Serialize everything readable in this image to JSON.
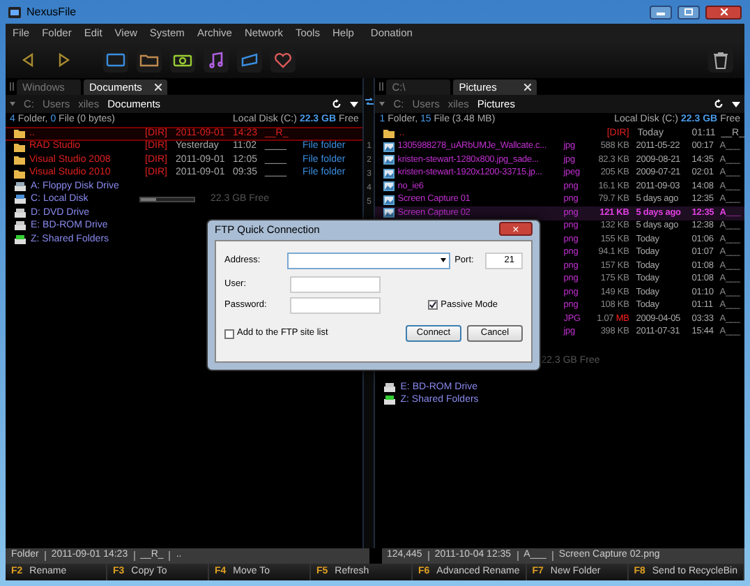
{
  "window": {
    "title": "NexusFile"
  },
  "menu": [
    "File",
    "Folder",
    "Edit",
    "View",
    "System",
    "Archive",
    "Network",
    "Tools",
    "Help",
    "Donation"
  ],
  "splitter_marks": [
    "1",
    "2",
    "3",
    "4",
    "5"
  ],
  "left": {
    "tabs": [
      {
        "label": "Windows",
        "selected": false
      },
      {
        "label": "Documents",
        "selected": true
      }
    ],
    "breadcrumb": [
      "C:",
      "Users",
      "xiles",
      "Documents"
    ],
    "summary": "**4** Folder, **0** File (0 bytes)",
    "disk": "Local Disk (C:)",
    "disk_size": "22.3 GB",
    "disk_free": "Free",
    "folders": [
      {
        "name": "..",
        "tag": "[DIR]",
        "date": "2011-09-01",
        "time": "14:23",
        "attr": "__R_",
        "selected": true
      },
      {
        "name": "RAD Studio",
        "tag": "[DIR]",
        "date": "Yesterday",
        "time": "11:02",
        "attr": "____",
        "type": "File folder",
        "selected": false
      },
      {
        "name": "Visual Studio 2008",
        "tag": "[DIR]",
        "date": "2011-09-01",
        "time": "12:05",
        "attr": "____",
        "type": "File folder",
        "selected": false
      },
      {
        "name": "Visual Studio 2010",
        "tag": "[DIR]",
        "date": "2011-09-01",
        "time": "09:35",
        "attr": "____",
        "type": "File folder",
        "selected": false
      }
    ],
    "drives": [
      {
        "kind": "floppy",
        "name": "A: Floppy Disk Drive"
      },
      {
        "kind": "disk",
        "name": "C: Local Disk",
        "level": 0.3,
        "free": "22.3 GB Free"
      },
      {
        "kind": "optical",
        "name": "D: DVD Drive"
      },
      {
        "kind": "optical",
        "name": "E: BD-ROM Drive"
      },
      {
        "kind": "network",
        "name": "Z: Shared Folders"
      }
    ],
    "status": [
      "Folder",
      "2011-09-01 14:23",
      "__R_",
      ".."
    ]
  },
  "right": {
    "tabs": [
      {
        "label": "C:\\",
        "selected": false
      },
      {
        "label": "Pictures",
        "selected": true
      }
    ],
    "breadcrumb": [
      "C:",
      "Users",
      "xiles",
      "Pictures"
    ],
    "summary": "**1** Folder, **15** File (3.48 MB)",
    "disk": "Local Disk (C:)",
    "disk_size": "22.3 GB",
    "disk_free": "Free",
    "folders": [
      {
        "name": "..",
        "tag": "[DIR]",
        "date": "Today",
        "time": "01:11",
        "attr": "__R_"
      }
    ],
    "files": [
      {
        "name": "1305988278_uARbUMJe_Wallcate.c...",
        "ext": "jpg",
        "size": "588 KB",
        "date": "2011-05-22",
        "time": "00:17",
        "attr": "A___",
        "selected": false,
        "large": false
      },
      {
        "name": "kristen-stewart-1280x800.jpg_sade...",
        "ext": "jpg",
        "size": "82.3 KB",
        "date": "2009-08-21",
        "time": "14:35",
        "attr": "A___",
        "selected": false,
        "large": false
      },
      {
        "name": "kristen-stewart-1920x1200-33715.jp...",
        "ext": "jpeg",
        "size": "205 KB",
        "date": "2009-07-21",
        "time": "02:01",
        "attr": "A___",
        "selected": false,
        "large": false
      },
      {
        "name": "no_ie6",
        "ext": "png",
        "size": "16.1 KB",
        "date": "2011-09-03",
        "time": "14:08",
        "attr": "A___",
        "selected": false,
        "large": false
      },
      {
        "name": "Screen Capture 01",
        "ext": "png",
        "size": "79.7 KB",
        "date": "5 days ago",
        "time": "12:35",
        "attr": "A___",
        "selected": false,
        "large": false
      },
      {
        "name": "Screen Capture 02",
        "ext": "png",
        "size": "121 KB",
        "date": "5 days ago",
        "time": "12:35",
        "attr": "A___",
        "selected": true,
        "large": false
      },
      {
        "ext": "png",
        "size": "132 KB",
        "date": "5 days ago",
        "time": "12:38",
        "attr": "A___",
        "selected": false,
        "large": false
      },
      {
        "ext": "png",
        "size": "155 KB",
        "date": "Today",
        "time": "01:06",
        "attr": "A___",
        "selected": false,
        "large": false
      },
      {
        "ext": "png",
        "size": "94.1 KB",
        "date": "Today",
        "time": "01:07",
        "attr": "A___",
        "selected": false,
        "large": false
      },
      {
        "ext": "png",
        "size": "157 KB",
        "date": "Today",
        "time": "01:08",
        "attr": "A___",
        "selected": false,
        "large": false
      },
      {
        "ext": "png",
        "size": "175 KB",
        "date": "Today",
        "time": "01:08",
        "attr": "A___",
        "selected": false,
        "large": false
      },
      {
        "ext": "png",
        "size": "149 KB",
        "date": "Today",
        "time": "01:10",
        "attr": "A___",
        "selected": false,
        "large": false
      },
      {
        "ext": "png",
        "size": "108 KB",
        "date": "Today",
        "time": "01:11",
        "attr": "A___",
        "selected": false,
        "large": false
      },
      {
        "ext": "JPG",
        "size": "1.07 MB",
        "date": "2009-04-05",
        "time": "03:33",
        "attr": "A___",
        "selected": false,
        "large": true
      },
      {
        "ext": "jpg",
        "size": "398 KB",
        "date": "2011-07-31",
        "time": "15:44",
        "attr": "A___",
        "selected": false,
        "large": false
      }
    ],
    "drives": [
      {
        "free": "22.3 GB Free"
      },
      {
        "kind": "optical",
        "name": "E: BD-ROM Drive"
      },
      {
        "kind": "network",
        "name": "Z: Shared Folders"
      }
    ],
    "status": [
      "124,445",
      "2011-10-04 12:35",
      "A___",
      "Screen Capture 02.png"
    ]
  },
  "function_keys": [
    {
      "key": "F2",
      "label": "Rename"
    },
    {
      "key": "F3",
      "label": "Copy To"
    },
    {
      "key": "F4",
      "label": "Move To"
    },
    {
      "key": "F5",
      "label": "Refresh"
    },
    {
      "key": "F6",
      "label": "Advanced Rename"
    },
    {
      "key": "F7",
      "label": "New Folder"
    },
    {
      "key": "F8",
      "label": "Send to RecycleBin"
    }
  ],
  "dialog": {
    "title": "FTP Quick Connection",
    "close": "×",
    "address_label": "Address:",
    "port_label": "Port:",
    "port": "21",
    "user_label": "User:",
    "password_label": "Password:",
    "passive_label": "Passive Mode",
    "passive": true,
    "add_label": "Add to the FTP site list",
    "add": false,
    "buttons": [
      "Connect",
      "Cancel"
    ]
  }
}
